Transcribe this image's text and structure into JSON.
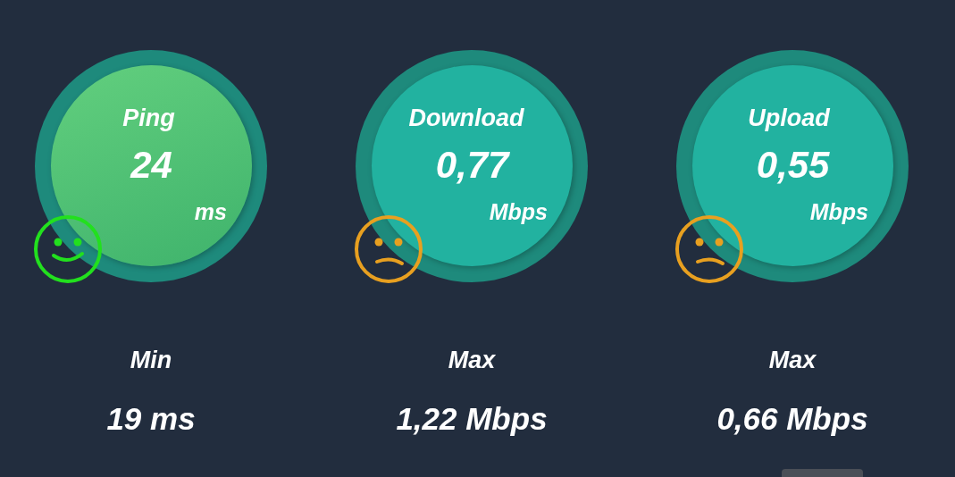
{
  "metrics": [
    {
      "kind": "ping",
      "label": "Ping",
      "value": "24",
      "unit": "ms",
      "happy": true,
      "color": "#22e01e",
      "stat_label": "Min",
      "stat_value": "19 ms"
    },
    {
      "kind": "download",
      "label": "Download",
      "value": "0,77",
      "unit": "Mbps",
      "happy": false,
      "color": "#e8a020",
      "stat_label": "Max",
      "stat_value": "1,22 Mbps"
    },
    {
      "kind": "upload",
      "label": "Upload",
      "value": "0,55",
      "unit": "Mbps",
      "happy": false,
      "color": "#e8a020",
      "stat_label": "Max",
      "stat_value": "0,66 Mbps"
    }
  ]
}
